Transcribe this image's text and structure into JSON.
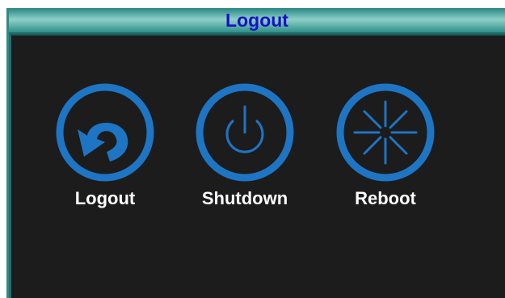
{
  "window": {
    "title": "Logout"
  },
  "actions": [
    {
      "label": "Logout",
      "icon": "logout-arrow-icon"
    },
    {
      "label": "Shutdown",
      "icon": "power-icon"
    },
    {
      "label": "Reboot",
      "icon": "reboot-asterisk-icon"
    }
  ],
  "colors": {
    "title_bar": "#5fb3ad",
    "title_text": "#1a10c8",
    "background": "#1c1c1c",
    "icon_blue": "#1e75c4",
    "label_text": "#ffffff"
  }
}
